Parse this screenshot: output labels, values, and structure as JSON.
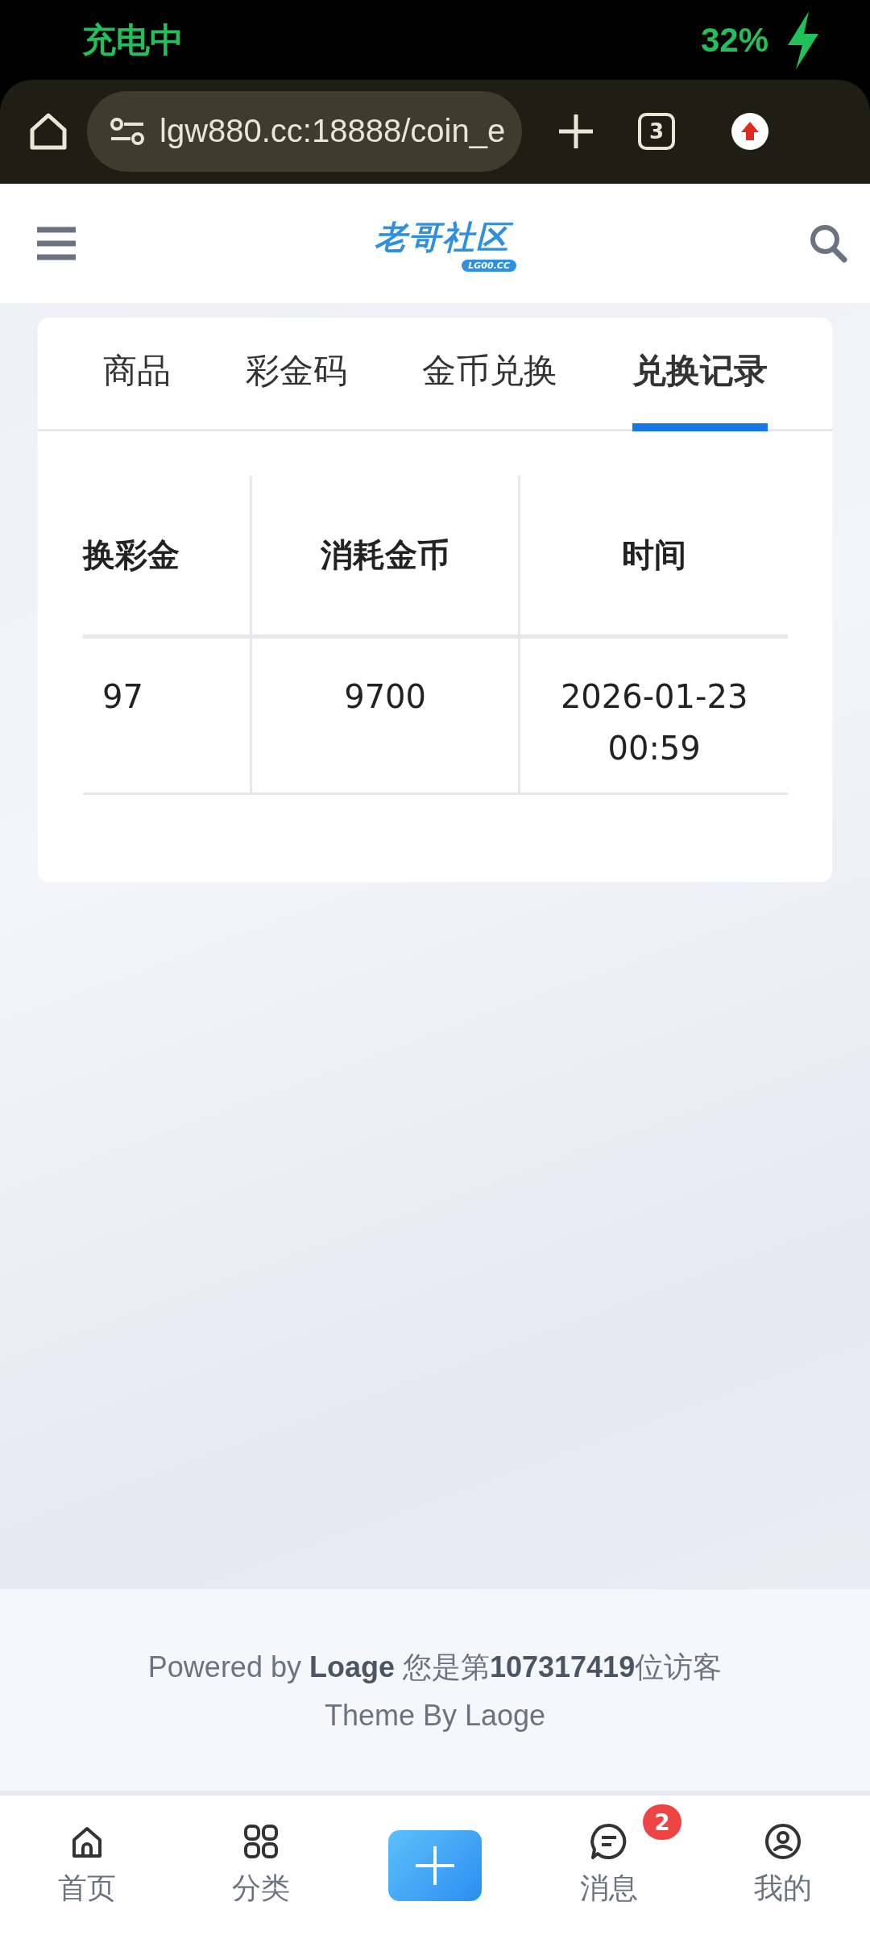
{
  "status_bar": {
    "charging": "充电中",
    "battery": "32%"
  },
  "browser": {
    "url": "lgw880.cc:18888/coin_e",
    "tab_count": "3"
  },
  "header": {
    "logo": "老哥社区",
    "logo_sub": "LG00.CC"
  },
  "tabs": [
    {
      "label": "商品",
      "selected": false
    },
    {
      "label": "彩金码",
      "selected": false
    },
    {
      "label": "金币兑换",
      "selected": false
    },
    {
      "label": "兑换记录",
      "selected": true
    }
  ],
  "table": {
    "columns": [
      "换彩金",
      "消耗金币",
      "时间"
    ],
    "rows": [
      [
        "97",
        "9700",
        "2026-01-23 00:59"
      ]
    ]
  },
  "footer": {
    "line1": "Powered by **Loage** 您是第**107317419**位访客",
    "line2": "Theme By Laoge"
  },
  "bottom_nav": [
    {
      "kind": "home",
      "label": "首页"
    },
    {
      "kind": "grid",
      "label": "分类"
    },
    {
      "kind": "add"
    },
    {
      "kind": "chat",
      "label": "消息",
      "badge": "2"
    },
    {
      "kind": "user",
      "label": "我的"
    }
  ]
}
